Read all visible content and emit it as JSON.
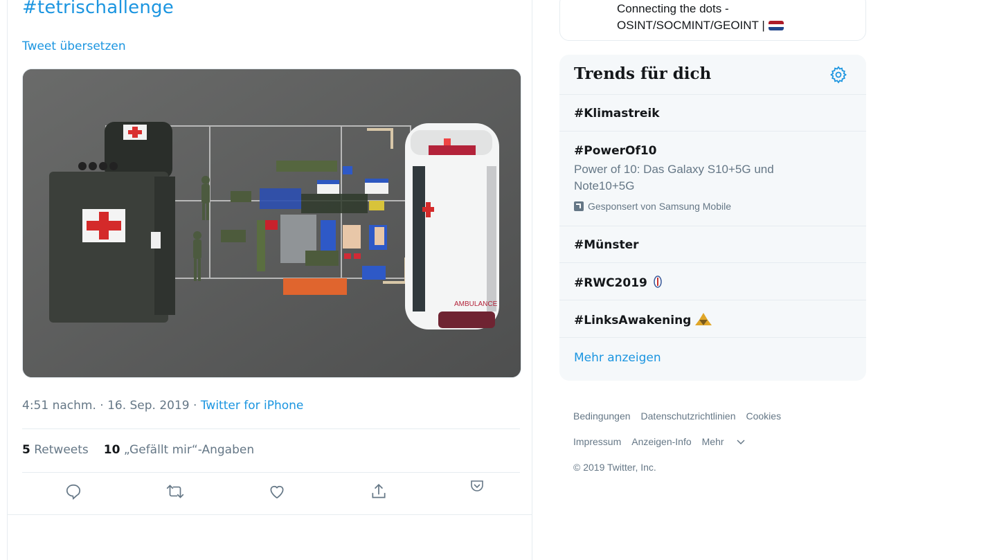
{
  "tweet": {
    "hashtag": "#tetrischallenge",
    "translate_label": "Tweet übersetzen",
    "time": "4:51 nachm. · 16. Sep. 2019 · ",
    "source": "Twitter for iPhone",
    "retweets_count": "5",
    "retweets_label": "Retweets",
    "likes_count": "10",
    "likes_label": "„Gefällt mir“-Angaben",
    "image_texts": {
      "ambulance": "AMBULANCE"
    }
  },
  "who_to_follow": {
    "description_line1": "Connecting the dots -",
    "description_line2": "OSINT/SOCMINT/GEOINT |"
  },
  "trends": {
    "title": "Trends für dich",
    "items": [
      {
        "name": "#Klimastreik"
      },
      {
        "name": "#PowerOf10",
        "description": "Power of 10: Das Galaxy S10+5G und Note10+5G",
        "promoted": "Gesponsert von Samsung Mobile"
      },
      {
        "name": "#Münster"
      },
      {
        "name": "#RWC2019"
      },
      {
        "name": "#LinksAwakening"
      }
    ],
    "more_label": "Mehr anzeigen"
  },
  "footer": {
    "links_row1": [
      "Bedingungen",
      "Datenschutzrichtlinien",
      "Cookies"
    ],
    "links_row2": [
      "Impressum",
      "Anzeigen-Info",
      "Mehr"
    ],
    "copyright": "© 2019 Twitter, Inc."
  },
  "colors": {
    "accent": "#1b95e0",
    "secondary_text": "#657786",
    "border": "#e6ecf0",
    "trends_bg": "#f5f8fa"
  },
  "icons": {
    "actions": [
      "reply-icon",
      "retweet-icon",
      "like-icon",
      "share-icon",
      "pocket-icon"
    ],
    "trends_settings": "gear-icon",
    "promoted": "promoted-icon",
    "footer_more": "chevron-down-icon"
  }
}
